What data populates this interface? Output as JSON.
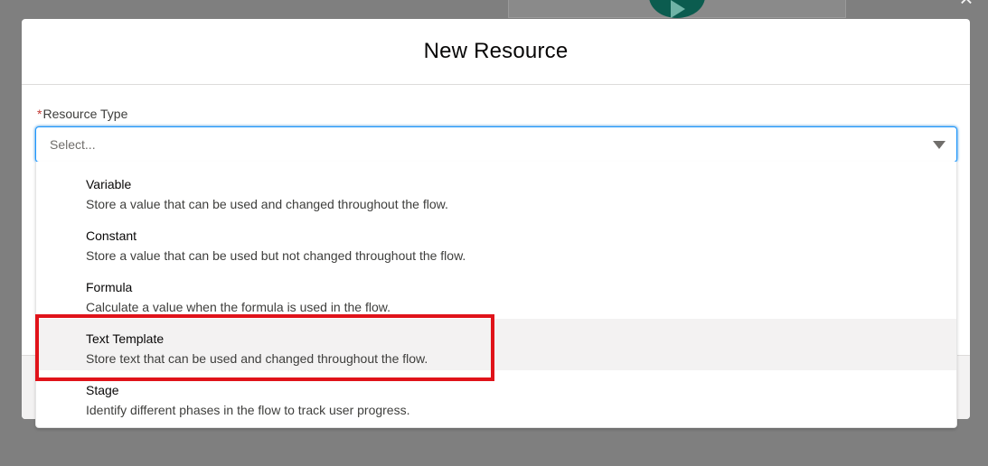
{
  "modal": {
    "title": "New Resource"
  },
  "resource_type": {
    "required_mark": "*",
    "label": "Resource Type",
    "placeholder": "Select..."
  },
  "options": [
    {
      "title": "Variable",
      "description": "Store a value that can be used and changed throughout the flow."
    },
    {
      "title": "Constant",
      "description": "Store a value that can be used but not changed throughout the flow."
    },
    {
      "title": "Formula",
      "description": "Calculate a value when the formula is used in the flow."
    },
    {
      "title": "Text Template",
      "description": "Store text that can be used and changed throughout the flow."
    },
    {
      "title": "Stage",
      "description": "Identify different phases in the flow to track user progress."
    }
  ],
  "highlighted_option": "Text Template",
  "colors": {
    "overlay": "#7f7f7f",
    "focus_border": "#1b96ff",
    "highlight": "#e0131a",
    "required": "#c23934",
    "start_node": "#0b5c4f"
  },
  "icons": {
    "close": "close-icon",
    "dropdown": "chevron-down-icon",
    "start": "play-icon"
  }
}
